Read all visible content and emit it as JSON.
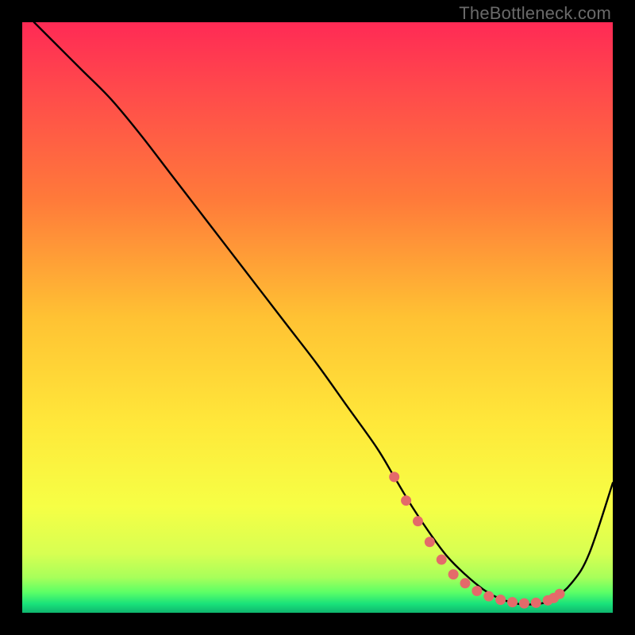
{
  "watermark": "TheBottleneck.com",
  "chart_data": {
    "type": "line",
    "title": "",
    "xlabel": "",
    "ylabel": "",
    "xlim": [
      0,
      100
    ],
    "ylim": [
      0,
      100
    ],
    "grid": false,
    "legend": false,
    "series": [
      {
        "name": "curve",
        "color": "#000000",
        "x": [
          2,
          6,
          10,
          15,
          20,
          25,
          30,
          35,
          40,
          45,
          50,
          55,
          60,
          63,
          66,
          69,
          72,
          75,
          78,
          80,
          82,
          84,
          86,
          88,
          90,
          93,
          96,
          100
        ],
        "y": [
          100,
          96,
          92,
          87,
          81,
          74.5,
          68,
          61.5,
          55,
          48.5,
          42,
          35,
          28,
          23,
          18,
          13.5,
          9.5,
          6.5,
          4,
          2.8,
          2,
          1.5,
          1.4,
          1.6,
          2.4,
          5,
          10,
          22
        ]
      },
      {
        "name": "highlight-dots",
        "color": "#e46a6a",
        "style": "dotted-thick",
        "x": [
          63,
          65,
          67,
          69,
          71,
          73,
          75,
          77,
          79,
          81,
          83,
          85,
          87,
          89,
          90,
          91
        ],
        "y": [
          23,
          19,
          15.5,
          12,
          9,
          6.5,
          5,
          3.7,
          2.8,
          2.2,
          1.8,
          1.6,
          1.7,
          2.1,
          2.5,
          3.2
        ]
      }
    ],
    "gradient": {
      "stops": [
        {
          "offset": 0.0,
          "color": "#ff2a55"
        },
        {
          "offset": 0.12,
          "color": "#ff4b4b"
        },
        {
          "offset": 0.3,
          "color": "#ff7a3a"
        },
        {
          "offset": 0.5,
          "color": "#ffc233"
        },
        {
          "offset": 0.68,
          "color": "#ffe83a"
        },
        {
          "offset": 0.82,
          "color": "#f6ff45"
        },
        {
          "offset": 0.9,
          "color": "#d7ff52"
        },
        {
          "offset": 0.94,
          "color": "#a8ff5a"
        },
        {
          "offset": 0.965,
          "color": "#5dff66"
        },
        {
          "offset": 0.985,
          "color": "#19e27a"
        },
        {
          "offset": 1.0,
          "color": "#0fb56e"
        }
      ]
    }
  }
}
